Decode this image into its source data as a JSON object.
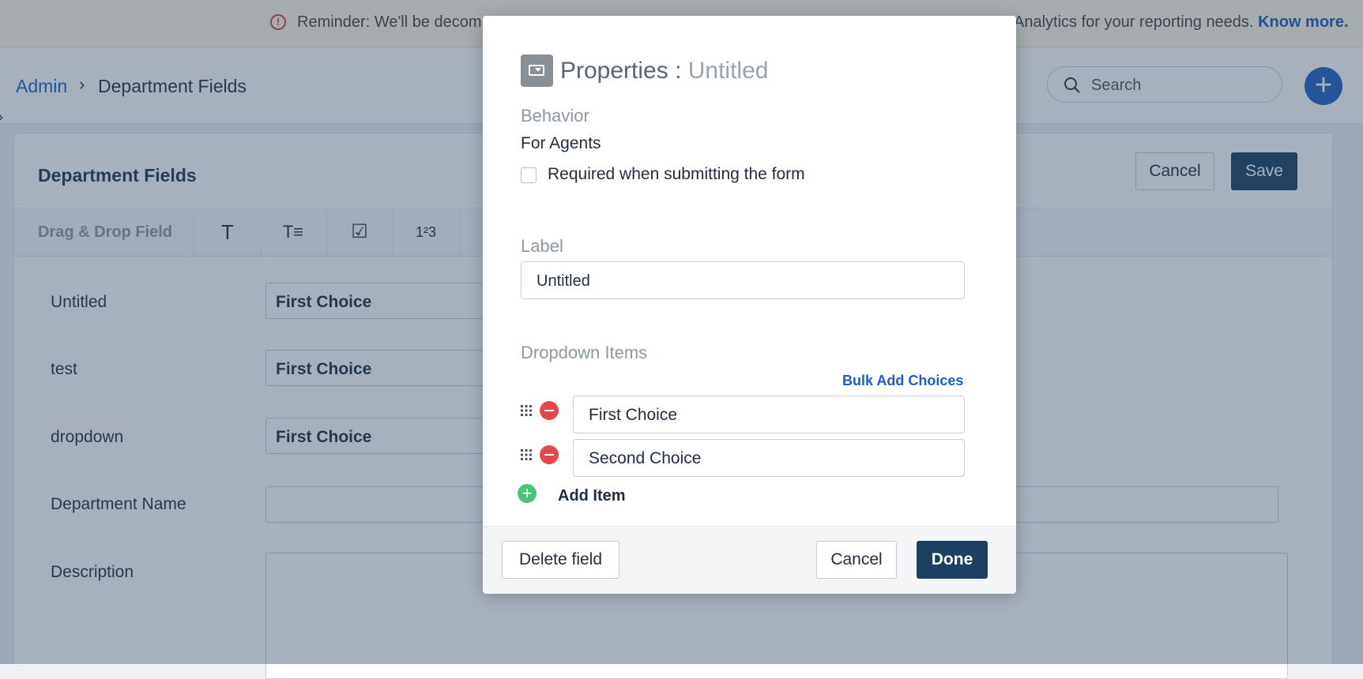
{
  "banner": {
    "text_left": "Reminder: We'll be decom",
    "text_right": "Analytics for your reporting needs.",
    "link": "Know more."
  },
  "breadcrumb": {
    "root": "Admin",
    "separator": "›",
    "current": "Department Fields"
  },
  "search": {
    "placeholder": "Search"
  },
  "card": {
    "title": "Department Fields",
    "cancel": "Cancel",
    "save": "Save",
    "toolbar_label": "Drag & Drop Field",
    "toolbar_icons": [
      "T",
      "T≡",
      "☑",
      "1²3"
    ]
  },
  "rows": [
    {
      "label": "Untitled",
      "value": "First Choice"
    },
    {
      "label": "test",
      "value": "First Choice"
    },
    {
      "label": "dropdown",
      "value": "First Choice"
    },
    {
      "label": "Department Name",
      "value": ""
    },
    {
      "label": "Description",
      "value": ""
    }
  ],
  "modal": {
    "title": "Properties :",
    "subtitle": "Untitled",
    "behavior_label": "Behavior",
    "behavior_sub": "For Agents",
    "required_label": "Required when submitting the form",
    "required_checked": false,
    "label_label": "Label",
    "label_value": "Untitled",
    "dropdown_label": "Dropdown Items",
    "bulk_add": "Bulk Add Choices",
    "items": [
      "First Choice",
      "Second Choice"
    ],
    "add_item": "Add Item",
    "delete": "Delete field",
    "cancel": "Cancel",
    "done": "Done"
  }
}
